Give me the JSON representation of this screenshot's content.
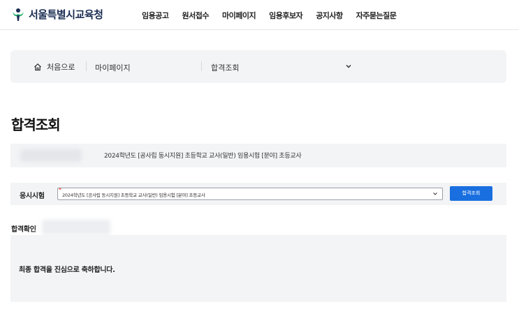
{
  "header": {
    "logo_text": "서울특별시교육청",
    "nav": [
      "임용공고",
      "원서접수",
      "마이페이지",
      "임용후보자",
      "공지사항",
      "자주묻는질문"
    ]
  },
  "breadcrumb": {
    "home_label": "처음으로",
    "level1": "마이페이지",
    "level2": "합격조회"
  },
  "page_title": "합격조회",
  "exam_info": {
    "exam_name": "2024학년도 [공사립 동시지원] 초등학교 교사(일반) 임용시험 [분야] 초등교사"
  },
  "search": {
    "label": "응시시험",
    "required_mark": "*",
    "selected_value": "2024학년도 [공사립 동시지원] 초등학교 교사(일반) 임용시험 [분야] 초등교사",
    "button_label": "합격조회"
  },
  "result": {
    "heading": "합격확인",
    "message": "최종 합격을 진심으로 축하합니다."
  },
  "colors": {
    "logo_blue": "#1c2e54",
    "logo_green": "#2bb673",
    "primary_button": "#1a6fe0",
    "panel_bg": "#f3f4f6",
    "required": "#e02424"
  }
}
